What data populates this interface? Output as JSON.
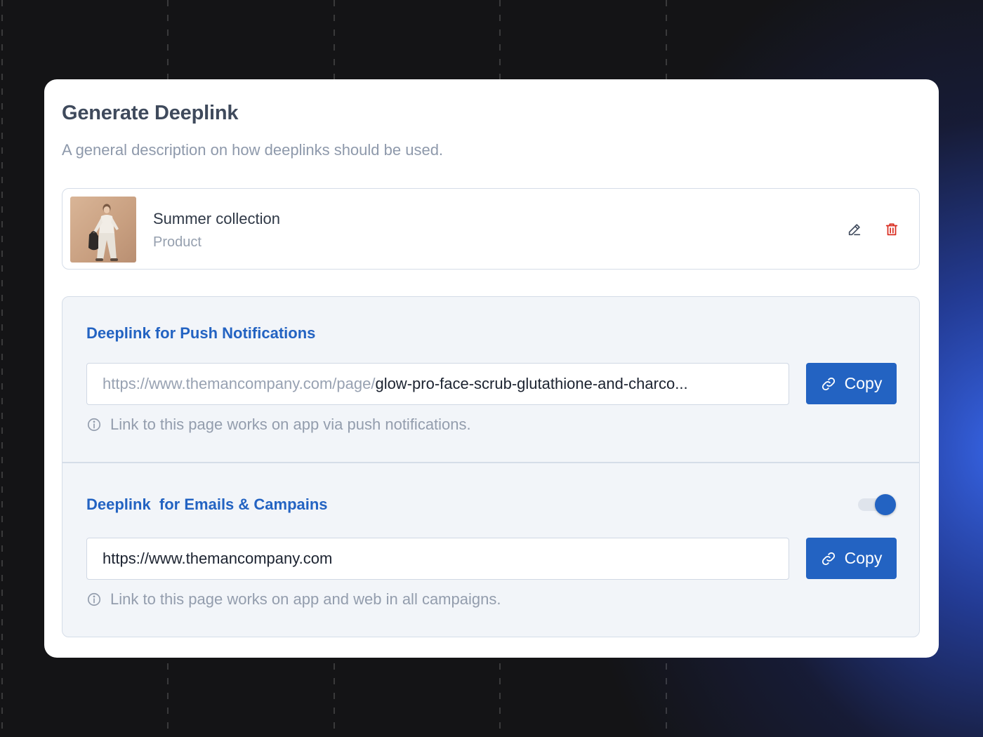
{
  "colors": {
    "accent": "#2363c2",
    "danger": "#d92d20",
    "title_text": "#3f4a5c",
    "muted_text": "#8e99ab",
    "panel_bg": "#f2f5f9"
  },
  "card": {
    "title": "Generate Deeplink",
    "description": "A general description on how deeplinks should be used."
  },
  "product": {
    "name": "Summer collection",
    "type": "Product",
    "thumbnail_icon": "product-photo",
    "edit_icon": "pencil-icon",
    "delete_icon": "trash-icon"
  },
  "push": {
    "title": "Deeplink for Push Notifications",
    "url_prefix": "https://www.themancompany.com/page/",
    "url_slug": "glow-pro-face-scrub-glutathione-and-charco...",
    "copy_label": "Copy",
    "copy_icon": "link-icon",
    "hint": "Link to this page works on app via push notifications.",
    "hint_icon": "info-icon"
  },
  "email": {
    "title": "Deeplink  for Emails & Campains",
    "url": "https://www.themancompany.com",
    "copy_label": "Copy",
    "copy_icon": "link-icon",
    "hint": "Link to this page works on app and web in all campaigns.",
    "hint_icon": "info-icon",
    "toggle_on": true
  }
}
